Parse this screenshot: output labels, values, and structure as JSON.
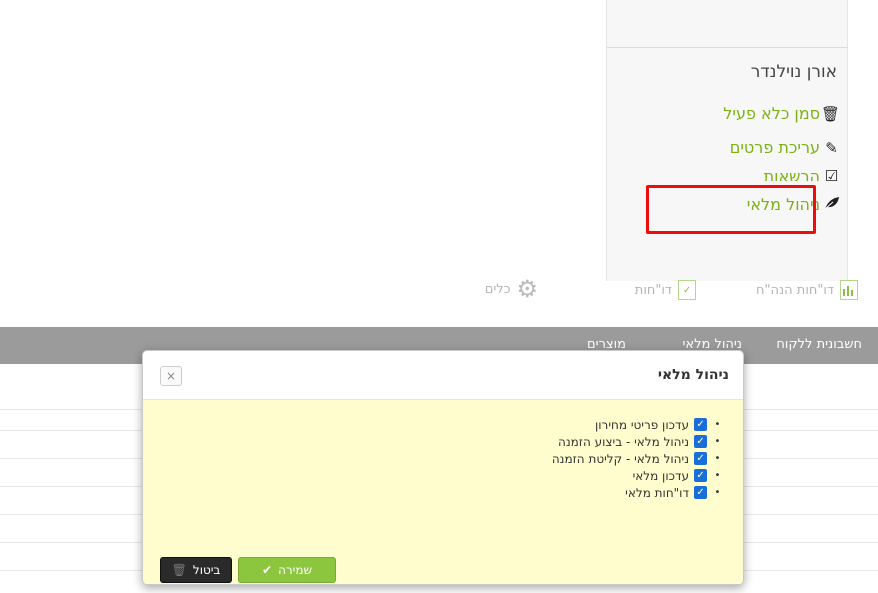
{
  "user_panel": {
    "user_name": "אורן נוילנדר",
    "menu": [
      {
        "label": "סמן כלא פעיל",
        "icon": "trash-icon"
      },
      {
        "label": "עריכת פרטים",
        "icon": "edit-icon"
      },
      {
        "label": "הרשאות",
        "icon": "checkbox-edit-icon"
      },
      {
        "label": "ניהול מלאי",
        "icon": "leaf-icon"
      }
    ]
  },
  "toolbar": {
    "items": [
      {
        "label": "דו\"חות הנה\"ח",
        "icon": "bar-chart-icon"
      },
      {
        "label": "דו\"חות",
        "icon": "check-doc-icon"
      },
      {
        "label": "כלים",
        "icon": "gear-icon"
      }
    ]
  },
  "navbar": {
    "items": [
      "חשבונית ללקוח",
      "ניהול מלאי",
      "מוצרים"
    ]
  },
  "modal": {
    "title": "ניהול מלאי",
    "close_label": "×",
    "permissions": [
      {
        "label": "עדכון פריטי מחירון",
        "checked": true
      },
      {
        "label": "ניהול מלאי - ביצוע הזמנה",
        "checked": true
      },
      {
        "label": "ניהול מלאי - קליטת הזמנה",
        "checked": true
      },
      {
        "label": "עדכון מלאי",
        "checked": true
      },
      {
        "label": "דו\"חות מלאי",
        "checked": true
      }
    ],
    "save_label": "שמירה",
    "cancel_label": "ביטול"
  },
  "colors": {
    "accent_green": "#7cb114",
    "highlight_red": "#ee0d0d",
    "modal_body_bg": "#fffdcd",
    "checkbox_blue": "#1a6ed8"
  }
}
